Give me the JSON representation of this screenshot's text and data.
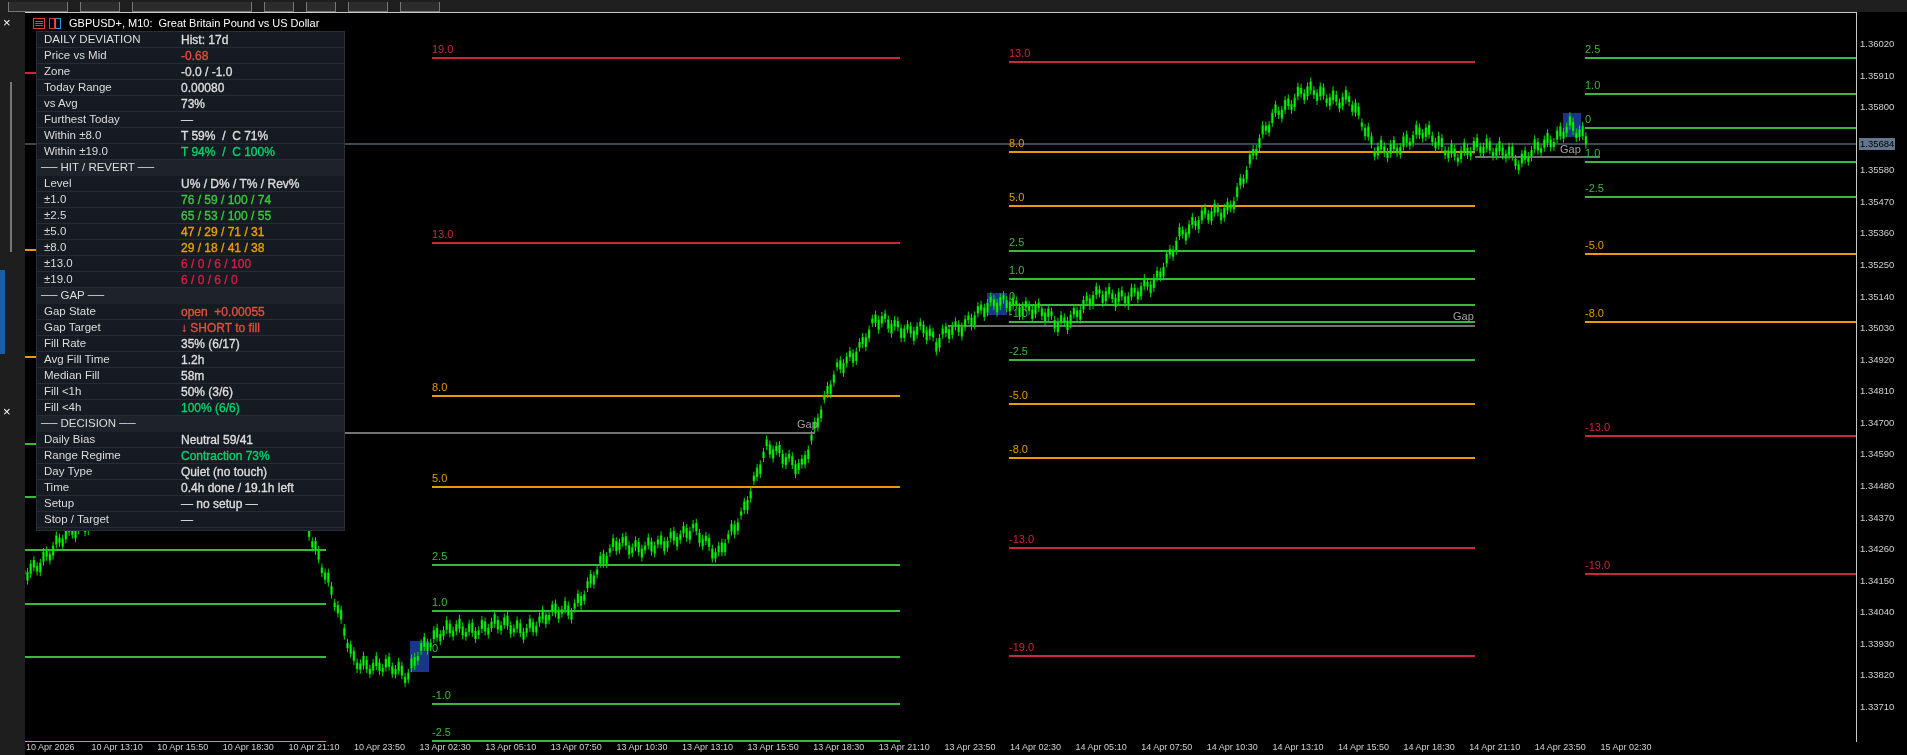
{
  "sidebar": {
    "close_buttons": [
      "×",
      "×"
    ]
  },
  "chart": {
    "title": "GBPUSD+, M10:  Great Britain Pound vs US Dollar",
    "info_panel": {
      "rows": [
        {
          "kind": "row",
          "label": "DAILY DEVIATION",
          "value": "Hist: 17d",
          "color": "#dcdcdc"
        },
        {
          "kind": "row",
          "label": "Price vs Mid",
          "value": "-0.68",
          "color": "#e0503a"
        },
        {
          "kind": "row",
          "label": "Zone",
          "value": "-0.0 / -1.0",
          "color": "#dcdcdc"
        },
        {
          "kind": "row",
          "label": "Today Range",
          "value": "0.00080",
          "color": "#dcdcdc"
        },
        {
          "kind": "row",
          "label": "vs Avg",
          "value": "73%",
          "color": "#dcdcdc"
        },
        {
          "kind": "row",
          "label": "Furthest Today",
          "value": "—",
          "color": "#dcdcdc"
        },
        {
          "kind": "row",
          "label": "Within ±8.0",
          "value": "T 59%  /  C 71%",
          "color": "#dcdcdc"
        },
        {
          "kind": "row",
          "label": "Within ±19.0",
          "value": "T 94%  /  C 100%",
          "color": "#00d26a"
        },
        {
          "kind": "section",
          "label": "── HIT / REVERT ──"
        },
        {
          "kind": "row",
          "label": "Level",
          "value": "U% / D% / T% / Rev%",
          "color": "#dcdcdc"
        },
        {
          "kind": "row",
          "label": "±1.0",
          "value": "76 / 59 / 100 / 74",
          "color": "#3cc83c"
        },
        {
          "kind": "row",
          "label": "±2.5",
          "value": "65 / 53 / 100 / 55",
          "color": "#3cc83c"
        },
        {
          "kind": "row",
          "label": "±5.0",
          "value": "47 / 29 / 71 / 31",
          "color": "#e8a000"
        },
        {
          "kind": "row",
          "label": "±8.0",
          "value": "29 / 18 / 41 / 38",
          "color": "#e8a000"
        },
        {
          "kind": "row",
          "label": "±13.0",
          "value": "6 / 0 / 6 / 100",
          "color": "#d02040"
        },
        {
          "kind": "row",
          "label": "±19.0",
          "value": "6 / 0 / 6 / 0",
          "color": "#d02040"
        },
        {
          "kind": "section",
          "label": "── GAP ──"
        },
        {
          "kind": "row",
          "label": "Gap State",
          "value": "open  +0.00055",
          "color": "#e0503a"
        },
        {
          "kind": "row",
          "label": "Gap Target",
          "value": "↓ SHORT to fill",
          "color": "#e0503a"
        },
        {
          "kind": "row",
          "label": "Fill Rate",
          "value": "35% (6/17)",
          "color": "#dcdcdc"
        },
        {
          "kind": "row",
          "label": "Avg Fill Time",
          "value": "1.2h",
          "color": "#dcdcdc"
        },
        {
          "kind": "row",
          "label": "Median Fill",
          "value": "58m",
          "color": "#dcdcdc"
        },
        {
          "kind": "row",
          "label": "Fill <1h",
          "value": "50% (3/6)",
          "color": "#dcdcdc"
        },
        {
          "kind": "row",
          "label": "Fill <4h",
          "value": "100% (6/6)",
          "color": "#00d26a"
        },
        {
          "kind": "section",
          "label": "── DECISION ──"
        },
        {
          "kind": "row",
          "label": "Daily Bias",
          "value": "Neutral 59/41",
          "color": "#dcdcdc"
        },
        {
          "kind": "row",
          "label": "Range Regime",
          "value": "Contraction 73%",
          "color": "#00d26a"
        },
        {
          "kind": "row",
          "label": "Day Type",
          "value": "Quiet (no touch)",
          "color": "#dcdcdc"
        },
        {
          "kind": "row",
          "label": "Time",
          "value": "0.4h done / 19.1h left",
          "color": "#dcdcdc"
        },
        {
          "kind": "row",
          "label": "Setup",
          "value": "— no setup —",
          "color": "#dcdcdc"
        },
        {
          "kind": "row",
          "label": "Stop / Target",
          "value": "—",
          "color": "#dcdcdc"
        }
      ]
    },
    "level_groups": [
      {
        "levels": [
          {
            "color": "#c8283c"
          },
          {
            "color": "#e89a00"
          },
          {
            "color": "#e89a00"
          },
          {
            "color": "#3cb83c"
          },
          {
            "color": "#3cb83c"
          },
          {
            "color": "#3cb83c"
          },
          {
            "color": "#3cb83c"
          },
          {
            "color": "#3cb83c"
          },
          {
            "color": "#e89a00"
          }
        ]
      },
      {
        "levels": [
          {
            "label": "19.0",
            "color": "#c8283c"
          },
          {
            "label": "13.0",
            "color": "#c8283c"
          },
          {
            "label": "8.0",
            "color": "#e89a00"
          },
          {
            "label": "5.0",
            "color": "#e89a00"
          },
          {
            "label": "2.5",
            "color": "#3cb83c"
          },
          {
            "label": "1.0",
            "color": "#3cb83c"
          },
          {
            "label": "0",
            "color": "#3cb83c"
          },
          {
            "label": "-1.0",
            "color": "#3cb83c"
          },
          {
            "label": "-2.5",
            "color": "#3cb83c"
          }
        ]
      },
      {
        "levels": [
          {
            "label": "13.0",
            "color": "#c8283c"
          },
          {
            "label": "8.0",
            "color": "#e89a00"
          },
          {
            "label": "5.0",
            "color": "#e89a00"
          },
          {
            "label": "2.5",
            "color": "#3cb83c"
          },
          {
            "label": "1.0",
            "color": "#3cb83c"
          },
          {
            "label": "0",
            "color": "#3cb83c"
          },
          {
            "label": "-1.0",
            "color": "#3cb83c"
          },
          {
            "label": "-2.5",
            "color": "#3cb83c"
          },
          {
            "label": "-5.0",
            "color": "#e89a00"
          },
          {
            "label": "-8.0",
            "color": "#e89a00"
          },
          {
            "label": "-13.0",
            "color": "#c8283c"
          },
          {
            "label": "-19.0",
            "color": "#c8283c"
          }
        ]
      },
      {
        "levels": [
          {
            "label": "2.5",
            "color": "#3cb83c"
          },
          {
            "label": "1.0",
            "color": "#3cb83c"
          },
          {
            "label": "0",
            "color": "#3cb83c"
          },
          {
            "label": "1.0",
            "color": "#3cb83c"
          },
          {
            "label": "-2.5",
            "color": "#3cb83c"
          },
          {
            "label": "-5.0",
            "color": "#e89a00"
          },
          {
            "label": "-8.0",
            "color": "#e89a00"
          },
          {
            "label": "-13.0",
            "color": "#c8283c"
          },
          {
            "label": "-19.0",
            "color": "#c8283c"
          }
        ]
      }
    ],
    "gap_labels": [
      "Gap",
      "Gap",
      "Gap"
    ],
    "current_price": "1.35684",
    "price_axis": [
      "1.36020",
      "1.35910",
      "1.35800",
      "1.35580",
      "1.35470",
      "1.35360",
      "1.35250",
      "1.35140",
      "1.35030",
      "1.34920",
      "1.34810",
      "1.34700",
      "1.34590",
      "1.34480",
      "1.34370",
      "1.34260",
      "1.34150",
      "1.34040",
      "1.33930",
      "1.33820",
      "1.33710"
    ],
    "time_axis": [
      "10 Apr 2026",
      "10 Apr 13:10",
      "10 Apr 15:50",
      "10 Apr 18:30",
      "10 Apr 21:10",
      "10 Apr 23:50",
      "13 Apr 02:30",
      "13 Apr 05:10",
      "13 Apr 07:50",
      "13 Apr 10:30",
      "13 Apr 13:10",
      "13 Apr 15:50",
      "13 Apr 18:30",
      "13 Apr 21:10",
      "13 Apr 23:50",
      "14 Apr 02:30",
      "14 Apr 05:10",
      "14 Apr 07:50",
      "14 Apr 10:30",
      "14 Apr 13:10",
      "14 Apr 15:50",
      "14 Apr 18:30",
      "14 Apr 21:10",
      "14 Apr 23:50",
      "15 Apr 02:30"
    ]
  }
}
